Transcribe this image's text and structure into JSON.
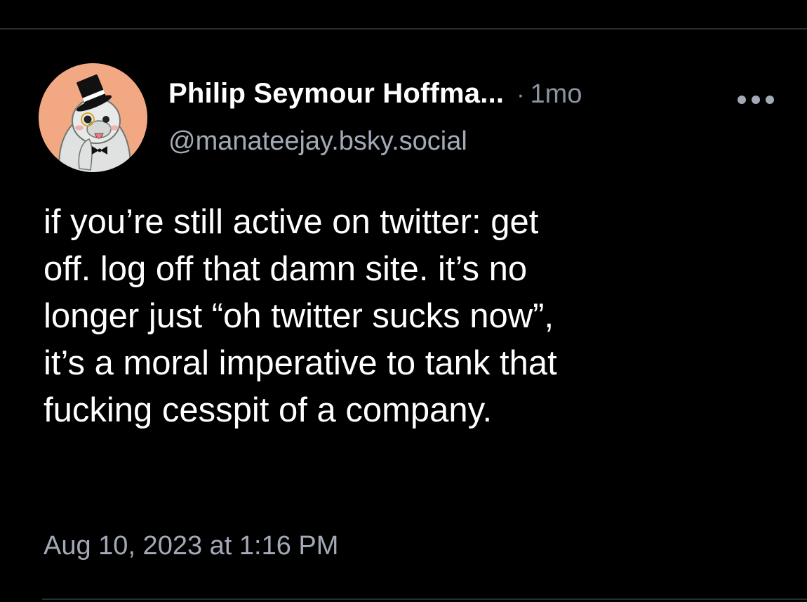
{
  "post": {
    "author": {
      "display_name": "Philip Seymour Hoffma...",
      "handle": "@manateejay.bsky.social",
      "avatar_icon": "manatee-top-hat-avatar"
    },
    "relative_time": "1mo",
    "separator": "·",
    "more_icon": "ellipsis-icon",
    "text": "if you’re still active on twitter: get\noff. log off that damn site. it’s no\nlonger just “oh twitter sucks now”,\nit’s a moral imperative to tank that\nfucking cesspit of a company.",
    "full_timestamp": "Aug 10, 2023 at 1:16 PM"
  },
  "colors": {
    "background": "#000000",
    "text_primary": "#ffffff",
    "text_secondary": "#a3aab6",
    "divider": "#2a2d33",
    "avatar_background": "#f2a882"
  }
}
